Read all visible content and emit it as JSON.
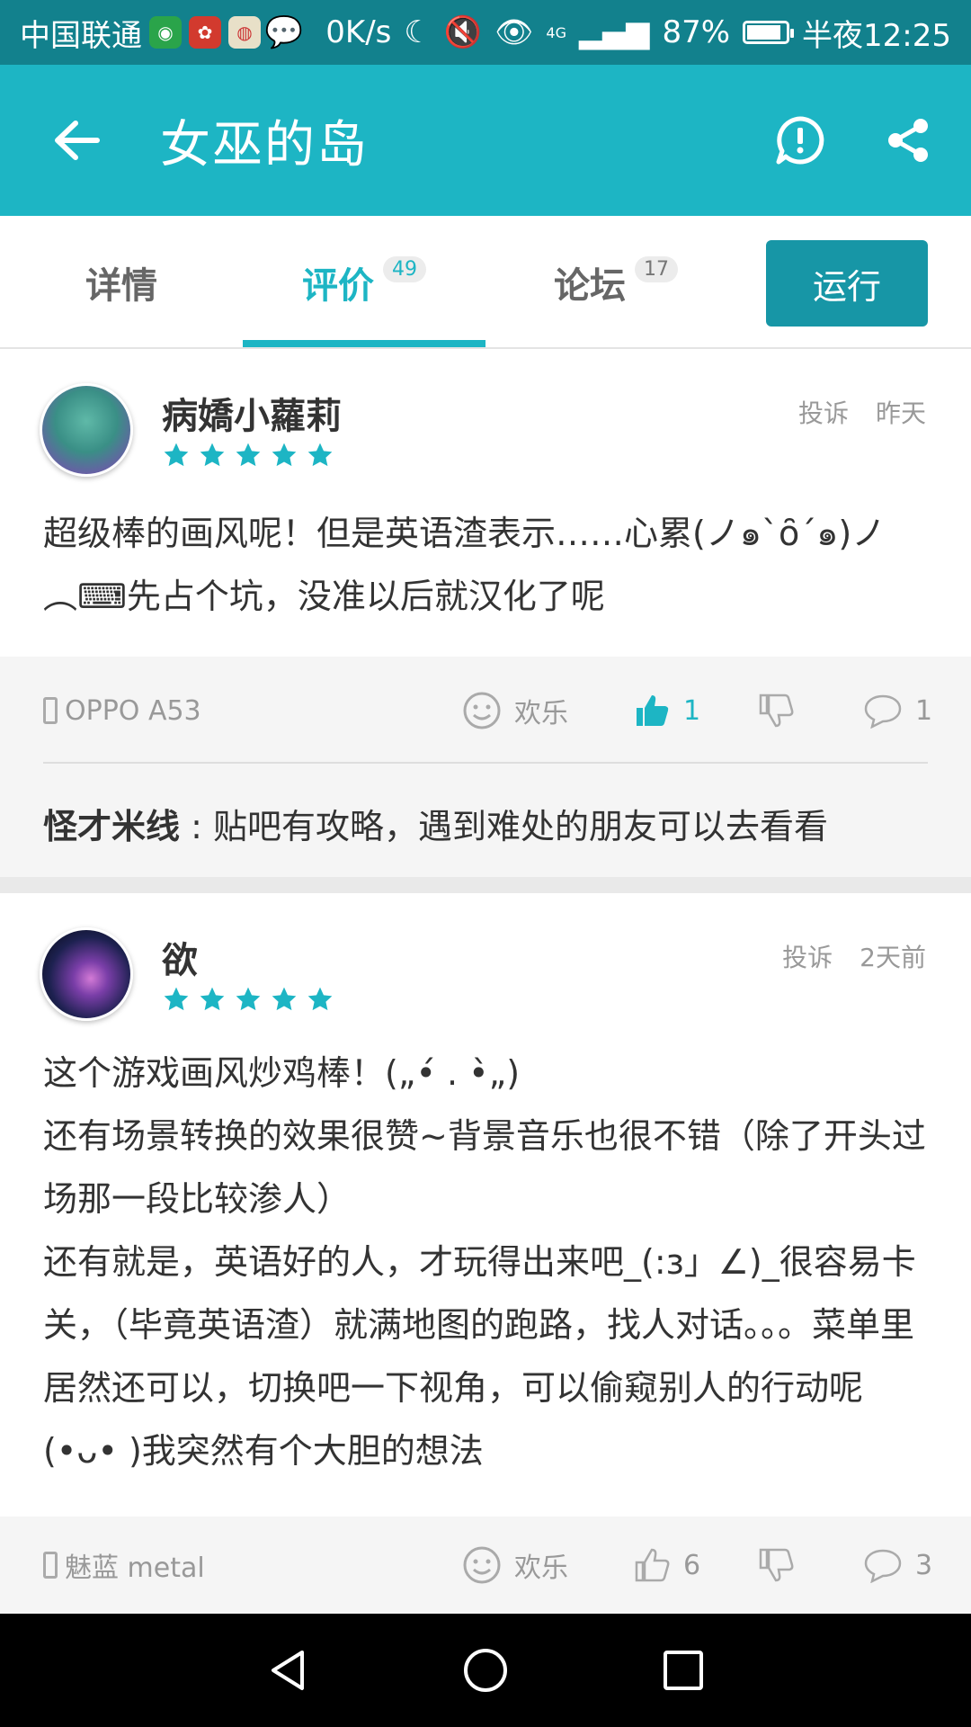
{
  "status_bar": {
    "carrier": "中国联通",
    "speed": "0K/s",
    "network": "4G",
    "battery": "87%",
    "battery_level": 0.87,
    "time": "半夜12:25"
  },
  "app_bar": {
    "title": "女巫的岛"
  },
  "tabs": [
    {
      "label": "详情",
      "badge": ""
    },
    {
      "label": "评价",
      "badge": "49"
    },
    {
      "label": "论坛",
      "badge": "17"
    }
  ],
  "run_button": "运行",
  "reviews": [
    {
      "username": "病嬌小蘿莉",
      "rating": 5,
      "report": "投诉",
      "time": "昨天",
      "content": "超级棒的画风呢！但是英语渣表示……心累(ノ๑`ȏ´๑)ノ︵⌨先占个坑，没准以后就汉化了呢",
      "device": "OPPO A53",
      "mood": "欢乐",
      "likes": "1",
      "comments": "1",
      "reply_user": "怪才米线",
      "reply_text": "贴吧有攻略，遇到难处的朋友可以去看看"
    },
    {
      "username": "欲",
      "rating": 5,
      "report": "投诉",
      "time": "2天前",
      "content": "这个游戏画风炒鸡棒！(„•́ . •̀„)\n还有场景转换的效果很赞~背景音乐也很不错（除了开头过场那一段比较渗人）\n还有就是，英语好的人，才玩得出来吧_(:з」∠)_很容易卡关，（毕竟英语渣）就满地图的跑路，找人对话。。。菜单里居然还可以，切换吧一下视角，可以偷窥别人的行动呢(•ᴗ• )我突然有个大胆的想法",
      "device": "魅蓝 metal",
      "mood": "欢乐",
      "likes": "6",
      "comments": "3"
    }
  ],
  "colors": {
    "accent": "#1db5c4",
    "status_bar": "#12818d",
    "run_button": "#1796a6"
  }
}
